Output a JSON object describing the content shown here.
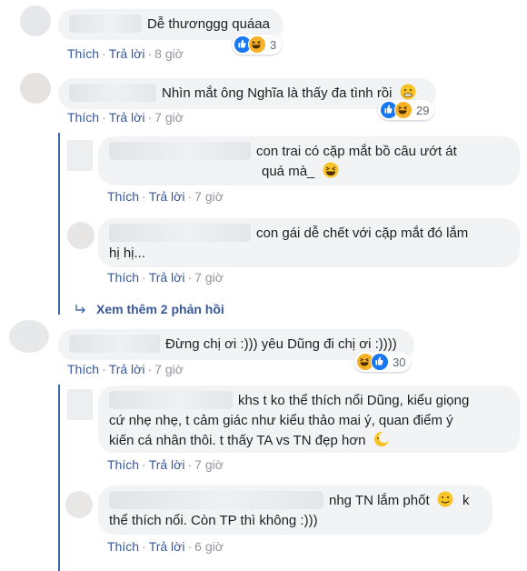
{
  "comments": [
    {
      "text": "Dễ thươnggg quáaa",
      "like": "Thích",
      "reply": "Trả lời",
      "time": "8 giờ",
      "reactions": "3"
    },
    {
      "text": "Nhìn mắt ông Nghĩa là thấy đa tình rồi",
      "like": "Thích",
      "reply": "Trả lời",
      "time": "7 giờ",
      "reactions": "29"
    },
    {
      "text": "con trai có cặp mắt bồ câu ướt át",
      "text2": "quá mà_",
      "like": "Thích",
      "reply": "Trả lời",
      "time": "7 giờ"
    },
    {
      "text": "con gái dễ chết với cặp mắt đó lắm",
      "text2": "hị hị...",
      "like": "Thích",
      "reply": "Trả lời",
      "time": "7 giờ"
    },
    {
      "text": "Đừng chị ơi :))) yêu Dũng đi chị ơi :))))",
      "like": "Thích",
      "reply": "Trả lời",
      "time": "7 giờ",
      "reactions": "30"
    },
    {
      "text": "khs t ko thể thích nổi Dũng, kiểu giọng",
      "text2": "cứ nhẹ nhẹ, t cảm giác như kiểu thảo mai ý, quan điểm ý",
      "text3": "kiến cá nhân thôi. t thấy TA vs TN đẹp hơn",
      "like": "Thích",
      "reply": "Trả lời",
      "time": "7 giờ"
    },
    {
      "text": "nhg TN lắm phốt",
      "text_after": "k",
      "text2": "thể thích nổi. Còn TP thì không :)))",
      "like": "Thích",
      "reply": "Trả lời",
      "time": "6 giờ"
    }
  ],
  "view_more": "Xem thêm 2 phản hồi",
  "separator": "·"
}
